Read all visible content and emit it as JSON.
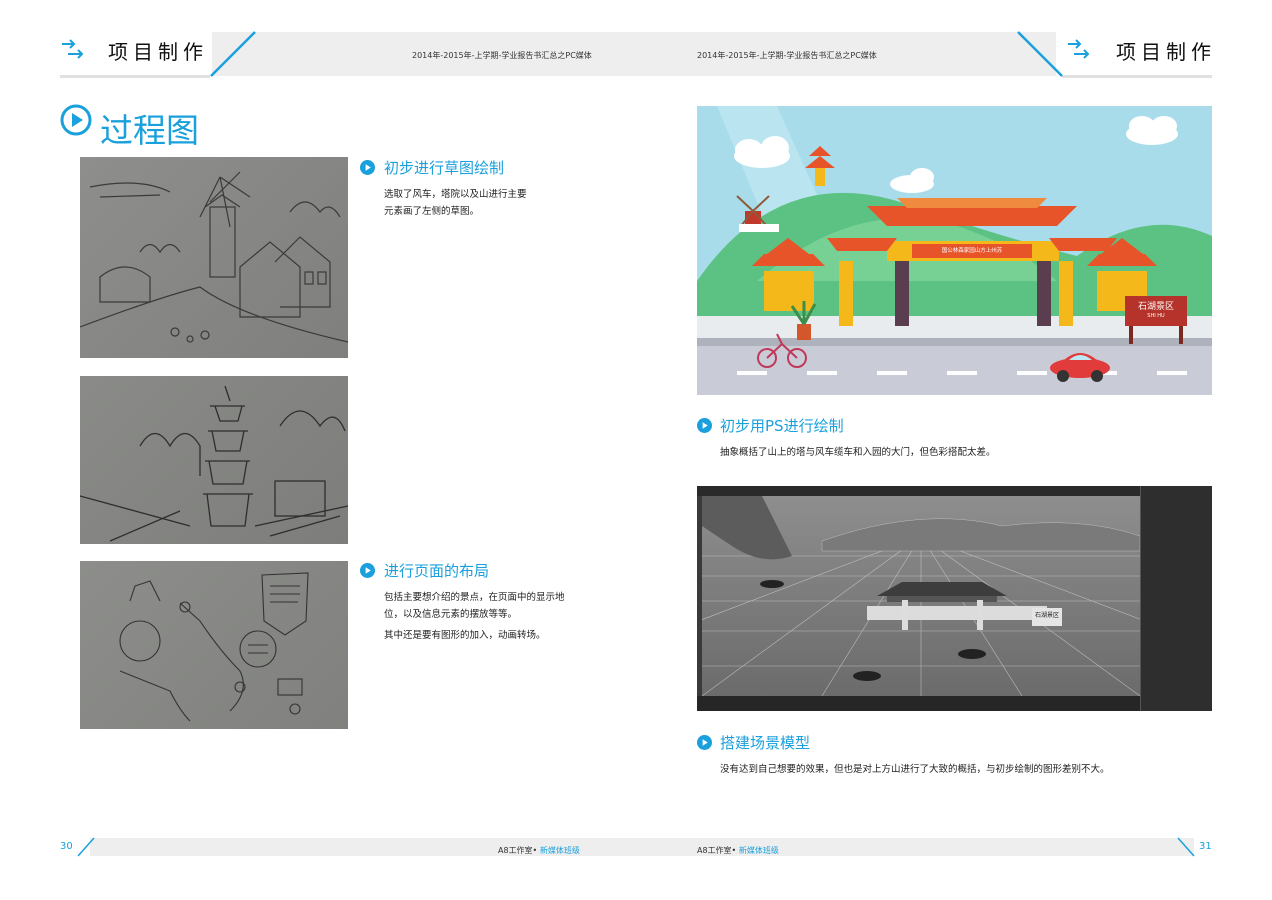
{
  "header": {
    "left_title": "项目制作",
    "right_title": "项目制作",
    "subtitle_left": "2014年-2015年-上学期-学业报告书汇总之PC媒体",
    "subtitle_right": "2014年-2015年-上学期-学业报告书汇总之PC媒体"
  },
  "page_title": "过程图",
  "sections": {
    "sketch": {
      "title": "初步进行草图绘制",
      "lines": [
        "选取了风车，塔院以及山进行主要",
        "元素画了左侧的草图。"
      ]
    },
    "layout": {
      "title": "进行页面的布局",
      "lines": [
        "包括主要想介绍的景点，在页面中的显示地",
        "位，以及信息元素的摆放等等。",
        "其中还是要有图形的加入，动画转场。"
      ]
    },
    "ps": {
      "title": "初步用PS进行绘制",
      "lines": [
        "抽象概括了山上的塔与风车缆车和入园的大门，但色彩搭配太差。"
      ]
    },
    "model": {
      "title": "搭建场景模型",
      "lines": [
        "没有达到自己想要的效果，但也是对上方山进行了大致的概括，与初步绘制的图形差别不大。"
      ]
    }
  },
  "illustration": {
    "gate_plaque": "国公林森家园山方上州苏",
    "sign_text": "石湖景区",
    "sign_sub": "SHI HU",
    "model_sign": "石湖景区"
  },
  "footer": {
    "left_page": "30",
    "right_page": "31",
    "studio_left": "A8工作室•",
    "class_left": "新媒体班级",
    "studio_right": "A8工作室•",
    "class_right": "新媒体班级"
  },
  "colors": {
    "accent": "#1aa0dc",
    "sky": "#a8dcea",
    "hill": "#5cc283",
    "roof": "#e8542a",
    "pillar": "#f5b81b"
  }
}
